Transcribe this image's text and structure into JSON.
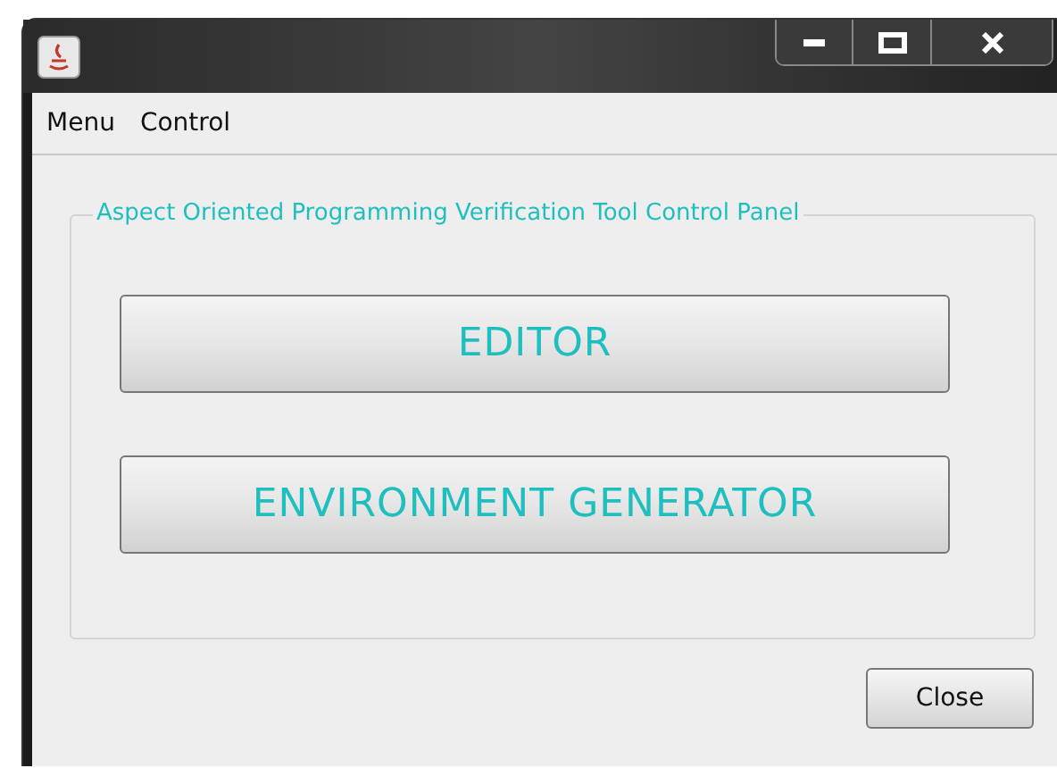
{
  "window": {
    "controls": [
      {
        "kind": "minimize"
      },
      {
        "kind": "maximize"
      },
      {
        "kind": "close"
      }
    ]
  },
  "menu": [
    "Menu",
    "Control"
  ],
  "panel": {
    "title": "Aspect Oriented Programming Verification Tool Control Panel",
    "buttons": [
      "EDITOR",
      "ENVIRONMENT GENERATOR"
    ]
  },
  "close_button": "Close"
}
